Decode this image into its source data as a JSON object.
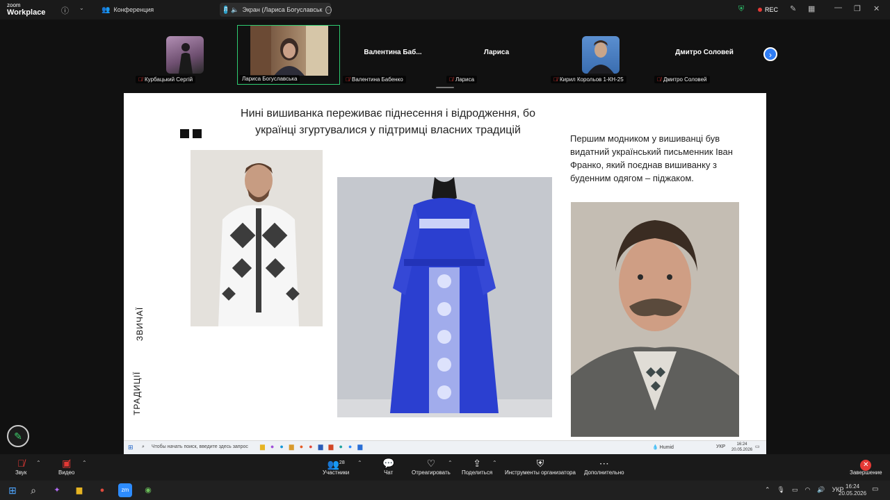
{
  "app": {
    "logo_top": "zoom",
    "logo_bottom": "Workplace"
  },
  "topbar": {
    "tab_conference": "Конференция",
    "tab_screen": "Экран (Лариса Богуславськ",
    "tab_screen_badge": "Л",
    "rec_label": "REC"
  },
  "participants": [
    {
      "name": "Курбацький Сергій",
      "display": "",
      "muted": true
    },
    {
      "name": "Лариса Богуславська",
      "display": "",
      "muted": false,
      "active": true
    },
    {
      "name": "Валентина Бабенко",
      "display": "Валентина  Баб...",
      "muted": true
    },
    {
      "name": "Лариса",
      "display": "Лариса",
      "muted": true
    },
    {
      "name": "Кирил Корольов 1-КН-25",
      "display": "",
      "muted": true
    },
    {
      "name": "Дмитро Соловей",
      "display": "Дмитро Соловей",
      "muted": true
    }
  ],
  "slide": {
    "title_line1": "Нині вишиванка переживає піднесення і відродження, бо",
    "title_line2": "українці згуртувалися у підтримці власних традицій",
    "right_text": "Першим модником у вишиванці був видатний український письменник Іван Франко, який поєднав вишиванку з буденним одягом – піджаком.",
    "vertical_1": "ЗВИЧАЇ",
    "vertical_2": "ТРАДИЦІЇ"
  },
  "inner_taskbar": {
    "search_placeholder": "Чтобы начать поиск, введите здесь запрос",
    "weather": "Humid",
    "lang": "УКР",
    "time": "16:24",
    "date": "20.05.2026"
  },
  "toolbar": {
    "audio": "Звук",
    "video": "Видео",
    "participants": "Участники",
    "participants_count": "28",
    "chat": "Чат",
    "react": "Отреагировать",
    "share": "Поделиться",
    "host_tools": "Инструменты организатора",
    "more": "Дополнительно",
    "end": "Завершение"
  },
  "taskbar": {
    "lang": "УКР",
    "time": "16:24",
    "date": "20.05.2026"
  },
  "colors": {
    "accent": "#2e7df6",
    "active_tile_border": "#2ecc71",
    "muted": "#e53935",
    "end": "#e53935"
  }
}
